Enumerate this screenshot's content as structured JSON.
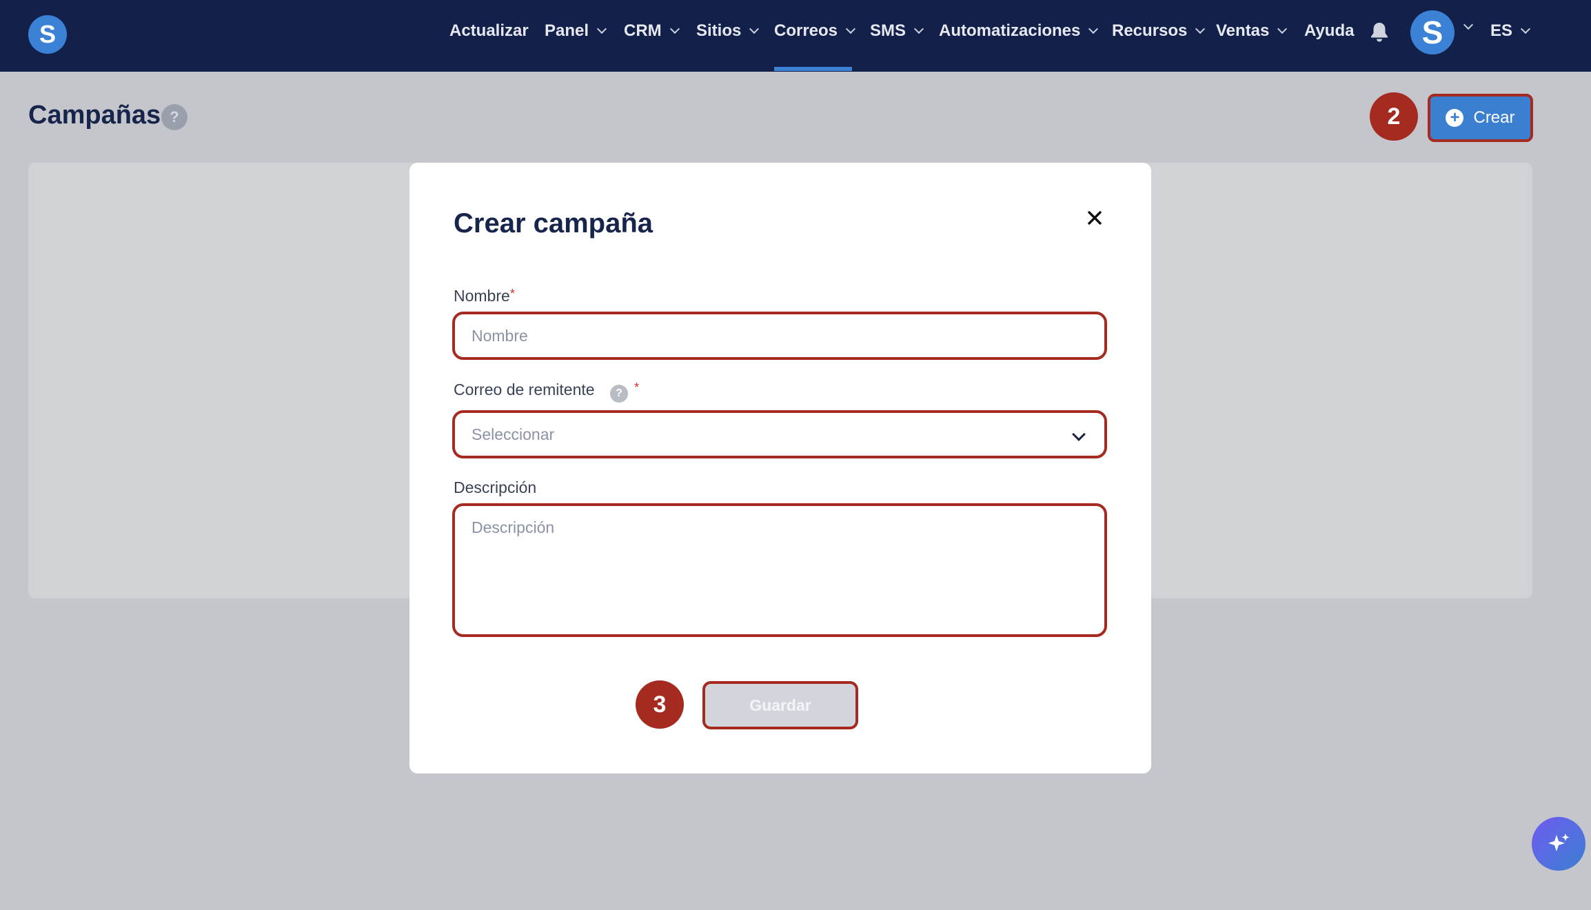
{
  "app": {
    "logo_letter": "S"
  },
  "nav": {
    "items": [
      {
        "label": "Actualizar",
        "has_menu": false
      },
      {
        "label": "Panel",
        "has_menu": true
      },
      {
        "label": "CRM",
        "has_menu": true
      },
      {
        "label": "Sitios",
        "has_menu": true
      },
      {
        "label": "Correos",
        "has_menu": true,
        "active": true
      },
      {
        "label": "SMS",
        "has_menu": true
      },
      {
        "label": "Automatizaciones",
        "has_menu": true
      },
      {
        "label": "Recursos",
        "has_menu": true
      },
      {
        "label": "Ventas",
        "has_menu": true
      },
      {
        "label": "Ayuda",
        "has_menu": false
      }
    ],
    "avatar_letter": "S",
    "language": "ES"
  },
  "page": {
    "title": "Campañas",
    "help_glyph": "?",
    "create_label": "Crear",
    "create_icon": "plus-circle-icon"
  },
  "steps": {
    "create": "2",
    "save": "3"
  },
  "modal": {
    "title": "Crear campaña",
    "close_glyph": "✕",
    "name": {
      "label": "Nombre",
      "required_mark": "*",
      "placeholder": "Nombre",
      "value": ""
    },
    "sender": {
      "label": "Correo de remitente",
      "help_glyph": "?",
      "required_mark": "*",
      "selected": "Seleccionar"
    },
    "description": {
      "label": "Descripción",
      "placeholder": "Descripción",
      "value": ""
    },
    "save_label": "Guardar"
  },
  "colors": {
    "nav_bg": "#12204a",
    "accent": "#3b7fd1",
    "highlight": "#a52a1f",
    "overlay": "#c4c6cb"
  },
  "fab": {
    "icon": "sparkles-icon"
  }
}
